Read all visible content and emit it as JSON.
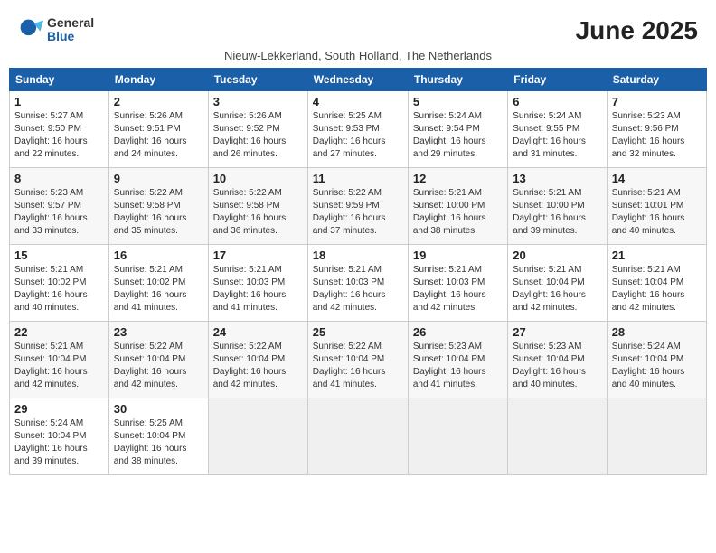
{
  "logo": {
    "general": "General",
    "blue": "Blue"
  },
  "title": "June 2025",
  "location": "Nieuw-Lekkerland, South Holland, The Netherlands",
  "weekdays": [
    "Sunday",
    "Monday",
    "Tuesday",
    "Wednesday",
    "Thursday",
    "Friday",
    "Saturday"
  ],
  "weeks": [
    [
      {
        "day": "1",
        "sunrise": "5:27 AM",
        "sunset": "9:50 PM",
        "daylight": "16 hours and 22 minutes."
      },
      {
        "day": "2",
        "sunrise": "5:26 AM",
        "sunset": "9:51 PM",
        "daylight": "16 hours and 24 minutes."
      },
      {
        "day": "3",
        "sunrise": "5:26 AM",
        "sunset": "9:52 PM",
        "daylight": "16 hours and 26 minutes."
      },
      {
        "day": "4",
        "sunrise": "5:25 AM",
        "sunset": "9:53 PM",
        "daylight": "16 hours and 27 minutes."
      },
      {
        "day": "5",
        "sunrise": "5:24 AM",
        "sunset": "9:54 PM",
        "daylight": "16 hours and 29 minutes."
      },
      {
        "day": "6",
        "sunrise": "5:24 AM",
        "sunset": "9:55 PM",
        "daylight": "16 hours and 31 minutes."
      },
      {
        "day": "7",
        "sunrise": "5:23 AM",
        "sunset": "9:56 PM",
        "daylight": "16 hours and 32 minutes."
      }
    ],
    [
      {
        "day": "8",
        "sunrise": "5:23 AM",
        "sunset": "9:57 PM",
        "daylight": "16 hours and 33 minutes."
      },
      {
        "day": "9",
        "sunrise": "5:22 AM",
        "sunset": "9:58 PM",
        "daylight": "16 hours and 35 minutes."
      },
      {
        "day": "10",
        "sunrise": "5:22 AM",
        "sunset": "9:58 PM",
        "daylight": "16 hours and 36 minutes."
      },
      {
        "day": "11",
        "sunrise": "5:22 AM",
        "sunset": "9:59 PM",
        "daylight": "16 hours and 37 minutes."
      },
      {
        "day": "12",
        "sunrise": "5:21 AM",
        "sunset": "10:00 PM",
        "daylight": "16 hours and 38 minutes."
      },
      {
        "day": "13",
        "sunrise": "5:21 AM",
        "sunset": "10:00 PM",
        "daylight": "16 hours and 39 minutes."
      },
      {
        "day": "14",
        "sunrise": "5:21 AM",
        "sunset": "10:01 PM",
        "daylight": "16 hours and 40 minutes."
      }
    ],
    [
      {
        "day": "15",
        "sunrise": "5:21 AM",
        "sunset": "10:02 PM",
        "daylight": "16 hours and 40 minutes."
      },
      {
        "day": "16",
        "sunrise": "5:21 AM",
        "sunset": "10:02 PM",
        "daylight": "16 hours and 41 minutes."
      },
      {
        "day": "17",
        "sunrise": "5:21 AM",
        "sunset": "10:03 PM",
        "daylight": "16 hours and 41 minutes."
      },
      {
        "day": "18",
        "sunrise": "5:21 AM",
        "sunset": "10:03 PM",
        "daylight": "16 hours and 42 minutes."
      },
      {
        "day": "19",
        "sunrise": "5:21 AM",
        "sunset": "10:03 PM",
        "daylight": "16 hours and 42 minutes."
      },
      {
        "day": "20",
        "sunrise": "5:21 AM",
        "sunset": "10:04 PM",
        "daylight": "16 hours and 42 minutes."
      },
      {
        "day": "21",
        "sunrise": "5:21 AM",
        "sunset": "10:04 PM",
        "daylight": "16 hours and 42 minutes."
      }
    ],
    [
      {
        "day": "22",
        "sunrise": "5:21 AM",
        "sunset": "10:04 PM",
        "daylight": "16 hours and 42 minutes."
      },
      {
        "day": "23",
        "sunrise": "5:22 AM",
        "sunset": "10:04 PM",
        "daylight": "16 hours and 42 minutes."
      },
      {
        "day": "24",
        "sunrise": "5:22 AM",
        "sunset": "10:04 PM",
        "daylight": "16 hours and 42 minutes."
      },
      {
        "day": "25",
        "sunrise": "5:22 AM",
        "sunset": "10:04 PM",
        "daylight": "16 hours and 41 minutes."
      },
      {
        "day": "26",
        "sunrise": "5:23 AM",
        "sunset": "10:04 PM",
        "daylight": "16 hours and 41 minutes."
      },
      {
        "day": "27",
        "sunrise": "5:23 AM",
        "sunset": "10:04 PM",
        "daylight": "16 hours and 40 minutes."
      },
      {
        "day": "28",
        "sunrise": "5:24 AM",
        "sunset": "10:04 PM",
        "daylight": "16 hours and 40 minutes."
      }
    ],
    [
      {
        "day": "29",
        "sunrise": "5:24 AM",
        "sunset": "10:04 PM",
        "daylight": "16 hours and 39 minutes."
      },
      {
        "day": "30",
        "sunrise": "5:25 AM",
        "sunset": "10:04 PM",
        "daylight": "16 hours and 38 minutes."
      },
      null,
      null,
      null,
      null,
      null
    ]
  ],
  "labels": {
    "sunrise": "Sunrise:",
    "sunset": "Sunset:",
    "daylight": "Daylight:"
  }
}
